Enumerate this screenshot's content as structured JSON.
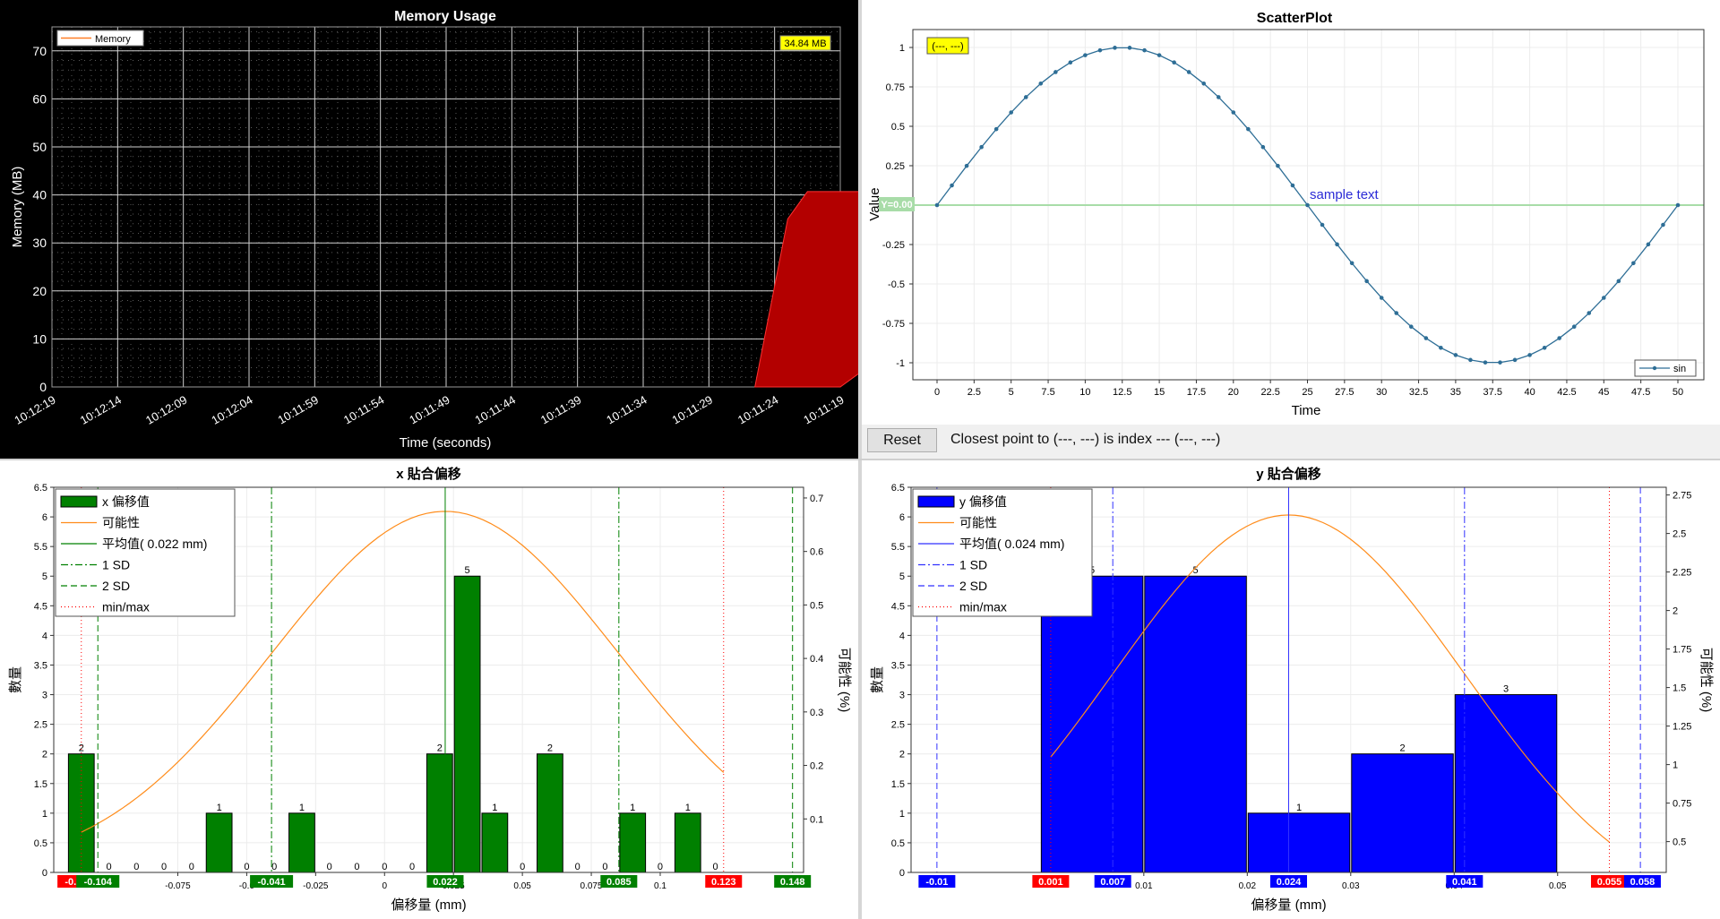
{
  "memory": {
    "title": "Memory Usage",
    "xlabel": "Time (seconds)",
    "ylabel": "Memory (MB)",
    "legend": "Memory",
    "badge": "34.84 MB",
    "yticks": [
      "0",
      "10",
      "20",
      "30",
      "40",
      "50",
      "60",
      "70"
    ],
    "xticks": [
      "10:12:19",
      "10:12:14",
      "10:12:09",
      "10:12:04",
      "10:11:59",
      "10:11:54",
      "10:11:49",
      "10:11:44",
      "10:11:39",
      "10:11:34",
      "10:11:29",
      "10:11:24",
      "10:11:19"
    ],
    "colors": {
      "bg": "#000000",
      "fill": "#b30000",
      "line": "#ff7f27",
      "badge": "#ffff00"
    }
  },
  "scatter": {
    "title": "ScatterPlot",
    "xlabel": "Time",
    "ylabel": "Value",
    "legend": "sin",
    "coord_badge": "(---, ---)",
    "hline_label": "Y=0.00",
    "annotation": "sample text",
    "xticks": [
      "0",
      "2.5",
      "5",
      "7.5",
      "10",
      "12.5",
      "15",
      "17.5",
      "20",
      "22.5",
      "25",
      "27.5",
      "30",
      "32.5",
      "35",
      "37.5",
      "40",
      "42.5",
      "45",
      "47.5",
      "50"
    ],
    "yticks": [
      "1",
      "0.75",
      "0.5",
      "0.25",
      "0",
      "-0.25",
      "-0.5",
      "-0.75",
      "-1"
    ],
    "colors": {
      "line": "#2e6e96",
      "hline": "#a8dca8"
    }
  },
  "controls": {
    "reset_label": "Reset",
    "closest_text": "Closest point to (---, ---) is index --- (---, ---)"
  },
  "xhist": {
    "title": "x 貼合偏移",
    "xlabel": "偏移量 (mm)",
    "ylabel": "數量",
    "y2label": "可能性 (%)",
    "legend": [
      "x 偏移值",
      "可能性",
      "平均值( 0.022 mm)",
      "1 SD",
      "2 SD",
      "min/max"
    ],
    "yticks": [
      "0",
      "0.5",
      "1",
      "1.5",
      "2",
      "2.5",
      "3",
      "3.5",
      "4",
      "4.5",
      "5",
      "5.5",
      "6",
      "6.5"
    ],
    "y2ticks": [
      "0.1",
      "0.2",
      "0.3",
      "0.4",
      "0.5",
      "0.6",
      "0.7"
    ],
    "xticks": [
      "-0.075",
      "-0.0",
      "-0.025",
      "0",
      "0.025",
      "0.05",
      "0.075",
      "0.1"
    ],
    "markers": [
      "-0.11",
      "-0.104",
      "-0.041",
      "0.022",
      "0.085",
      "0.123",
      "0.148"
    ],
    "colors": {
      "bar": "#008000",
      "curve": "#ff8c1a",
      "minmax": "#ff0000"
    }
  },
  "yhist": {
    "title": "y 貼合偏移",
    "xlabel": "偏移量 (mm)",
    "ylabel": "數量",
    "y2label": "可能性 (%)",
    "legend": [
      "y 偏移值",
      "可能性",
      "平均值( 0.024 mm)",
      "1 SD",
      "2 SD",
      "min/max"
    ],
    "yticks": [
      "0",
      "0.5",
      "1",
      "1.5",
      "2",
      "2.5",
      "3",
      "3.5",
      "4",
      "4.5",
      "5",
      "5.5",
      "6",
      "6.5"
    ],
    "y2ticks": [
      "0.5",
      "0.75",
      "1",
      "1.25",
      "1.5",
      "1.75",
      "2",
      "2.25",
      "2.5",
      "2.75"
    ],
    "xticks": [
      "0.01",
      "0.02",
      "0.03",
      "0.04",
      "0.05"
    ],
    "markers": [
      "-0.01",
      "0.001",
      "0.007",
      "0.024",
      "0.041",
      "0.055",
      "0.058"
    ],
    "colors": {
      "bar": "#0000ff",
      "curve": "#ff8c1a",
      "minmax": "#ff0000"
    }
  },
  "chart_data": [
    {
      "type": "area",
      "title": "Memory Usage",
      "xlabel": "Time (seconds)",
      "ylabel": "Memory (MB)",
      "ylim": [
        0,
        75
      ],
      "series": [
        {
          "name": "Memory",
          "x": [
            10.7,
            11.2,
            11.5,
            12,
            12.5,
            13.0,
            13.3,
            13.6,
            13.9,
            14.2,
            14.5,
            14.9,
            15.5
          ],
          "values": [
            0,
            35,
            40.7,
            40.7,
            40.7,
            40.7,
            39.8,
            36.9,
            36.9,
            34.8,
            34.8,
            34.8,
            34.84
          ]
        }
      ],
      "grid": true,
      "legend_position": "top-left"
    },
    {
      "type": "line",
      "title": "ScatterPlot",
      "xlabel": "Time",
      "ylabel": "Value",
      "xlim": [
        0,
        50
      ],
      "ylim": [
        -1,
        1
      ],
      "series": [
        {
          "name": "sin",
          "x": [
            0,
            1,
            2,
            3,
            4,
            5,
            6,
            7,
            8,
            9,
            10,
            11,
            12,
            13,
            14,
            15,
            16,
            17,
            18,
            19,
            20,
            21,
            22,
            23,
            24,
            25,
            26,
            27,
            28,
            29,
            30,
            31,
            32,
            33,
            34,
            35,
            36,
            37,
            38,
            39,
            40,
            41,
            42,
            43,
            44,
            45,
            46,
            47,
            48,
            49,
            50
          ],
          "values": [
            0,
            0.125,
            0.249,
            0.368,
            0.482,
            0.588,
            0.685,
            0.771,
            0.844,
            0.905,
            0.951,
            0.982,
            0.998,
            0.998,
            0.982,
            0.951,
            0.905,
            0.844,
            0.771,
            0.685,
            0.588,
            0.482,
            0.368,
            0.249,
            0.125,
            0,
            -0.125,
            -0.249,
            -0.368,
            -0.482,
            -0.588,
            -0.685,
            -0.771,
            -0.844,
            -0.905,
            -0.951,
            -0.982,
            -0.998,
            -0.998,
            -0.982,
            -0.951,
            -0.905,
            -0.844,
            -0.771,
            -0.685,
            -0.588,
            -0.482,
            -0.368,
            -0.249,
            -0.125,
            0
          ]
        }
      ],
      "grid": true,
      "legend_position": "bottom-right"
    },
    {
      "type": "bar",
      "title": "x 貼合偏移",
      "xlabel": "偏移量 (mm)",
      "ylabel": "數量",
      "xlim": [
        -0.12,
        0.152
      ],
      "ylim": [
        0,
        6.5
      ],
      "bin_centers": [
        -0.11,
        -0.1,
        -0.09,
        -0.08,
        -0.07,
        -0.06,
        -0.05,
        -0.04,
        -0.03,
        -0.02,
        -0.01,
        0,
        0.01,
        0.02,
        0.03,
        0.04,
        0.05,
        0.06,
        0.07,
        0.08,
        0.09,
        0.1,
        0.11,
        0.12
      ],
      "values": [
        2,
        0,
        0,
        0,
        0,
        1,
        0,
        0,
        1,
        0,
        0,
        0,
        0,
        2,
        5,
        1,
        0,
        2,
        0,
        0,
        1,
        0,
        1,
        0
      ],
      "mean": 0.022,
      "sd1": [
        -0.041,
        0.085
      ],
      "sd2": [
        -0.104,
        0.148
      ],
      "minmax": [
        -0.11,
        0.123
      ],
      "y2lim": [
        0,
        0.72
      ],
      "curve_peak": 0.675,
      "legend_position": "top-left"
    },
    {
      "type": "bar",
      "title": "y 貼合偏移",
      "xlabel": "偏移量 (mm)",
      "ylabel": "數量",
      "xlim": [
        -0.0125,
        0.0605
      ],
      "ylim": [
        0,
        6.5
      ],
      "bin_centers": [
        0.005,
        0.015,
        0.025,
        0.035,
        0.045
      ],
      "values": [
        5,
        5,
        1,
        2,
        3
      ],
      "mean": 0.024,
      "sd1": [
        0.007,
        0.041
      ],
      "sd2": [
        -0.01,
        0.058
      ],
      "minmax": [
        0.001,
        0.055
      ],
      "y2lim": [
        0.3,
        2.8
      ],
      "curve_peak": 2.62,
      "legend_position": "top-left"
    }
  ]
}
